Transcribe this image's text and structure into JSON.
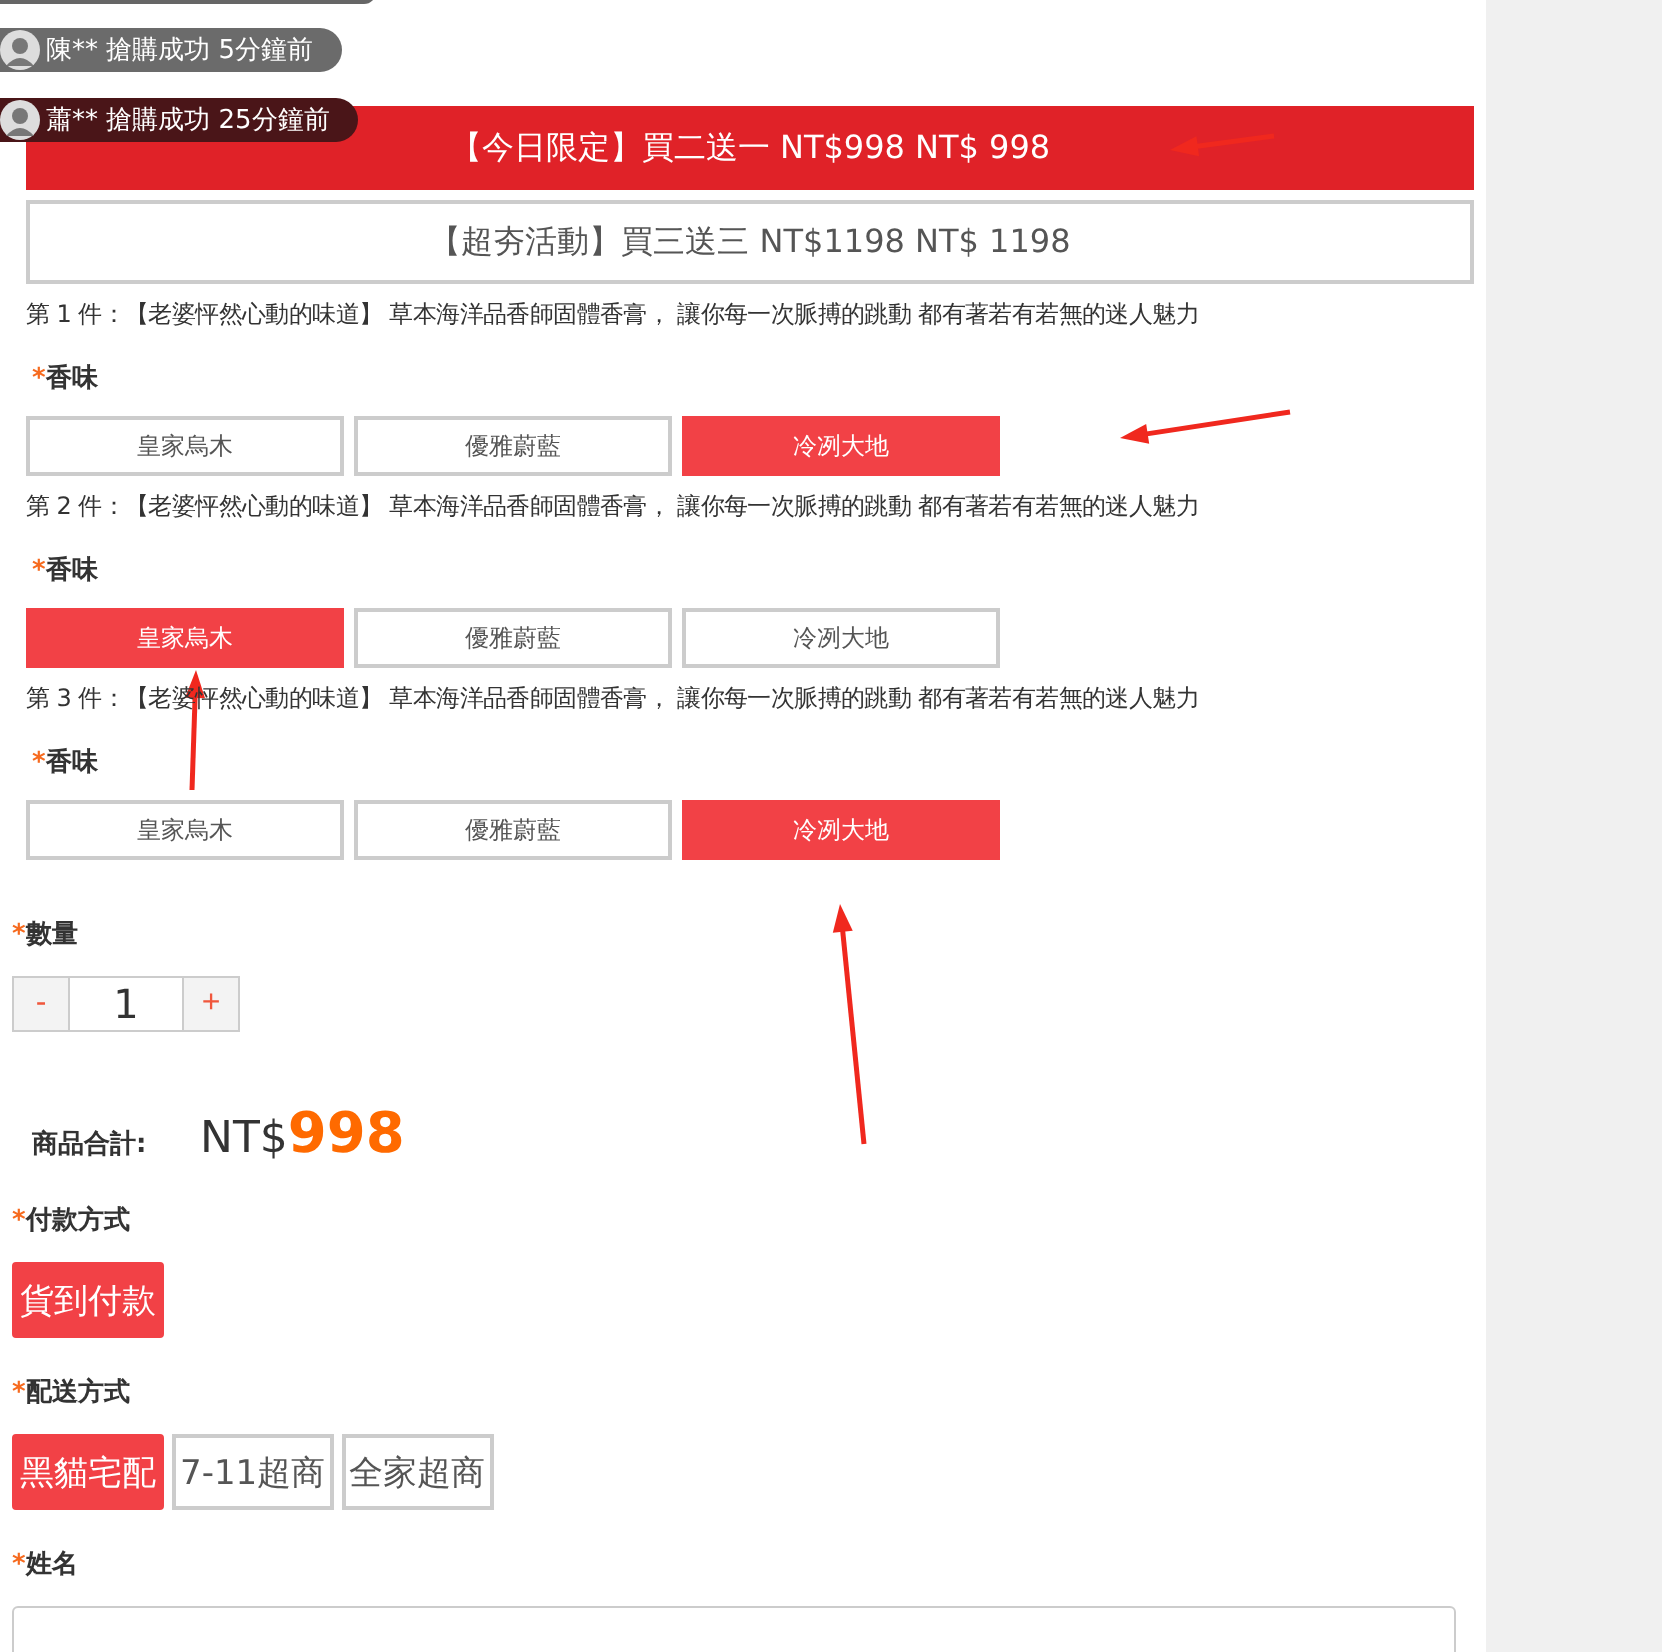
{
  "notifications": [
    {
      "text": "陳** 搶購成功 5分鐘前",
      "color": "#6b6b6b"
    },
    {
      "text": "蕭** 搶購成功 25分鐘前",
      "color": "#4a1518"
    }
  ],
  "promos": [
    {
      "label": "【今日限定】買二送一 NT$998 NT$ 998",
      "selected": true
    },
    {
      "label": "【超夯活動】買三送三 NT$1198 NT$ 1198",
      "selected": false
    }
  ],
  "items": [
    {
      "title": "第 1 件：【老婆怦然心動的味道】 草本海洋品香師固體香膏， 讓你每一次脈搏的跳動 都有著若有若無的迷人魅力",
      "mark": "*",
      "attr": "香味",
      "options": [
        {
          "label": "皇家烏木",
          "selected": false
        },
        {
          "label": "優雅蔚藍",
          "selected": false
        },
        {
          "label": "冷冽大地",
          "selected": true
        }
      ]
    },
    {
      "title": "第 2 件：【老婆怦然心動的味道】 草本海洋品香師固體香膏， 讓你每一次脈搏的跳動 都有著若有若無的迷人魅力",
      "mark": "*",
      "attr": "香味",
      "options": [
        {
          "label": "皇家烏木",
          "selected": true
        },
        {
          "label": "優雅蔚藍",
          "selected": false
        },
        {
          "label": "冷冽大地",
          "selected": false
        }
      ]
    },
    {
      "title": "第 3 件：【老婆怦然心動的味道】 草本海洋品香師固體香膏， 讓你每一次脈搏的跳動 都有著若有若無的迷人魅力",
      "mark": "*",
      "attr": "香味",
      "options": [
        {
          "label": "皇家烏木",
          "selected": false
        },
        {
          "label": "優雅蔚藍",
          "selected": false
        },
        {
          "label": "冷冽大地",
          "selected": true
        }
      ]
    }
  ],
  "quantity": {
    "mark": "*",
    "label": "數量",
    "minus": "-",
    "value": "1",
    "plus": "+"
  },
  "total": {
    "label": "商品合計:",
    "currency": "NT$",
    "amount": "998"
  },
  "payment": {
    "mark": "*",
    "label": "付款方式",
    "options": [
      {
        "label": "貨到付款",
        "selected": true
      }
    ]
  },
  "shipping": {
    "mark": "*",
    "label": "配送方式",
    "options": [
      {
        "label": "黑貓宅配",
        "selected": true
      },
      {
        "label": "7-11超商",
        "selected": false
      },
      {
        "label": "全家超商",
        "selected": false
      }
    ]
  },
  "name_field": {
    "mark": "*",
    "label": "姓名"
  }
}
